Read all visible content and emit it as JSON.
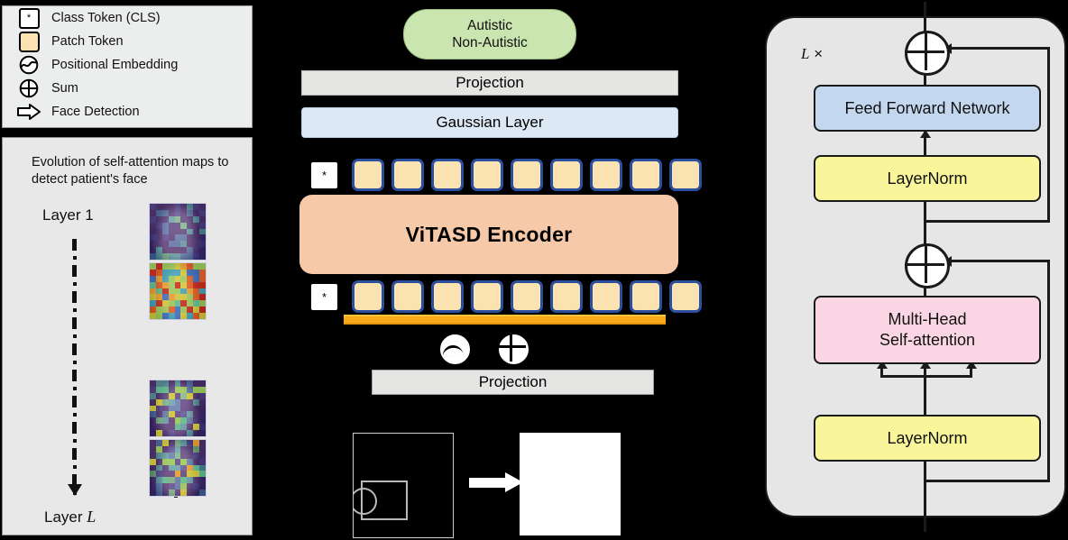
{
  "legend": {
    "items": [
      {
        "icon": "class-token-icon",
        "glyph": "*",
        "label": "Class Token (CLS)"
      },
      {
        "icon": "patch-token-icon",
        "glyph": "",
        "label": "Patch Token"
      },
      {
        "icon": "positional-embedding-icon",
        "glyph": "",
        "label": "Positional Embedding"
      },
      {
        "icon": "sum-icon",
        "glyph": "",
        "label": "Sum"
      },
      {
        "icon": "face-detection-arrow-icon",
        "glyph": "",
        "label": "Face Detection"
      }
    ]
  },
  "attention_panel": {
    "title": "Evolution of self-attention maps to detect patient's face",
    "first_layer_label": "Layer 1",
    "last_layer_label": "Layer ",
    "last_layer_symbol": "L",
    "maps": [
      {
        "name": "layer-1-attention-map"
      },
      {
        "name": "layer-2-attention-map"
      },
      {
        "name": "layer-l-minus-1-attention-map"
      },
      {
        "name": "layer-l-attention-map"
      }
    ]
  },
  "pipeline": {
    "output_label_line1": "Autistic",
    "output_label_line2": "Non-Autistic",
    "projection_top": "Projection",
    "gaussian_layer": "Gaussian Layer",
    "encoder": "ViTASD Encoder",
    "projection_bottom": "Projection",
    "cls_token_glyph": "*",
    "patch_token_count": 9,
    "strip_patch_count": 9,
    "grid_patch_count": 9,
    "colors": {
      "encoder": "#f6c9a8",
      "gaussian": "#dde8f5",
      "projection": "#e5e5e4",
      "label_pill": "#cbe5b0",
      "patch_token": "#fae3b0",
      "token_border": "#2b4f9e",
      "underline": "#f7a81b"
    }
  },
  "transformer_block": {
    "repeat_label": "L ×",
    "repeat_symbol": "L",
    "repeat_times_sign": "×",
    "feed_forward": "Feed Forward Network",
    "layernorm_top": "LayerNorm",
    "multihead_line1": "Multi-Head",
    "multihead_line2": "Self-attention",
    "layernorm_bottom": "LayerNorm",
    "colors": {
      "panel": "#e6e6e6",
      "ffn": "#c3d7ef",
      "layernorm": "#f8f59a",
      "mhsa": "#fad6e4"
    }
  }
}
